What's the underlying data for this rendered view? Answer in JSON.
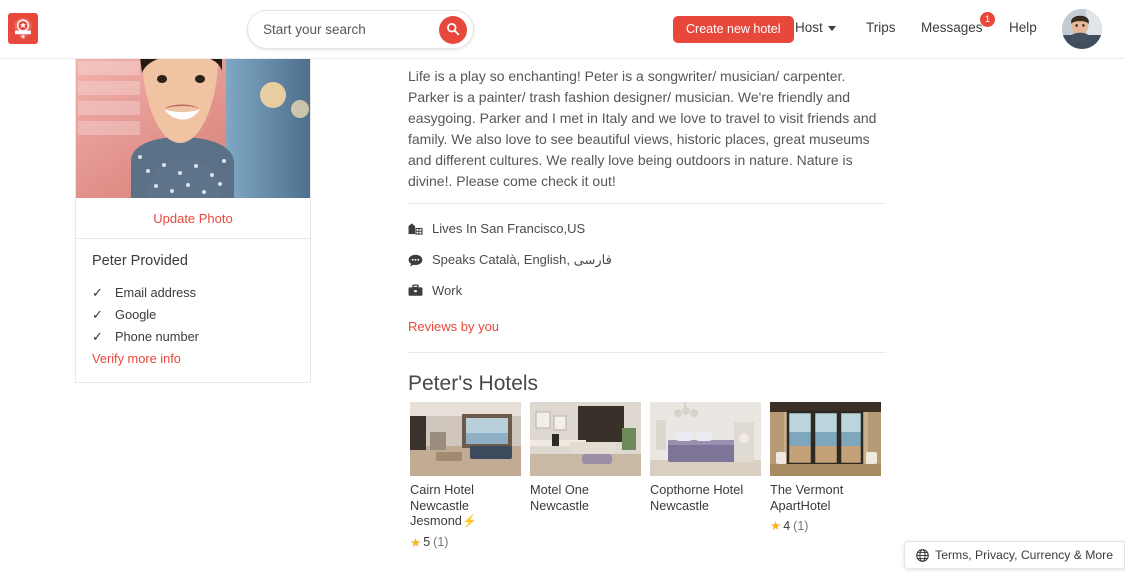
{
  "header": {
    "logo_icon": "location-pin-logo-icon",
    "logo_color": "#e8483b",
    "search": {
      "placeholder": "Start your search",
      "value": "",
      "icon": "search-icon"
    },
    "create_button": "Create new hotel",
    "nav": {
      "host": "Host",
      "trips": "Trips",
      "messages": "Messages",
      "messages_badge": "1",
      "help": "Help"
    },
    "avatar_icon": "user-avatar"
  },
  "sidebar": {
    "update_photo": "Update Photo",
    "provided_title": "Peter Provided",
    "verifications": [
      {
        "label": "Email address",
        "icon": "check-icon"
      },
      {
        "label": "Google",
        "icon": "check-icon"
      },
      {
        "label": "Phone number",
        "icon": "check-icon"
      }
    ],
    "verify_more": "Verify more info"
  },
  "main": {
    "cutoff_text": "..",
    "bio": "Life is a play so enchanting! Peter is a songwriter/ musician/ carpenter. Parker is a painter/ trash fashion designer/ musician. We're friendly and easygoing. Parker and I met in Italy and we love to travel to visit friends and family. We also love to see beautiful views, historic places, great museums and different cultures. We really love being outdoors in nature. Nature is divine!. Please come check it out!",
    "info": {
      "lives": "Lives In San Francisco,US",
      "lives_icon": "home-building-icon",
      "speaks": "Speaks Català, English, فارسی",
      "speaks_icon": "speech-bubble-icon",
      "work": "Work",
      "work_icon": "briefcase-icon"
    },
    "reviews_link": "Reviews by you",
    "hotels_title": "Peter's Hotels",
    "hotels": [
      {
        "name": "Cairn Hotel Newcastle Jesmond",
        "instant_book": true,
        "bolt_icon": "lightning-bolt-icon",
        "rating": "5",
        "reviews": "(1)",
        "image_alt": "hotel-room-lounge-window-view"
      },
      {
        "name": "Motel One Newcastle",
        "instant_book": false,
        "rating": "",
        "reviews": "",
        "image_alt": "hotel-room-dark-headboard"
      },
      {
        "name": "Copthorne Hotel Newcastle",
        "instant_book": false,
        "rating": "",
        "reviews": "",
        "image_alt": "hotel-room-purple-bed"
      },
      {
        "name": "The Vermont ApartHotel",
        "instant_book": false,
        "rating": "4",
        "reviews": "(1)",
        "image_alt": "hotel-room-balcony-sea-view"
      }
    ]
  },
  "footer": {
    "label": "Terms, Privacy, Currency & More",
    "icon": "globe-icon"
  },
  "colors": {
    "brand_red": "#e8483b",
    "star_yellow": "#f5b320",
    "text": "#484848"
  }
}
